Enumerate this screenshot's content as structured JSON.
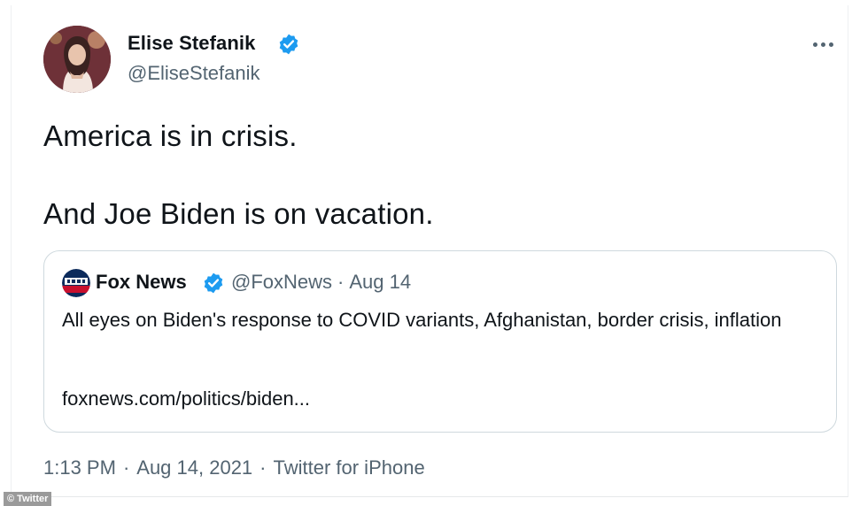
{
  "tweet": {
    "author": {
      "name": "Elise Stefanik",
      "handle": "@EliseStefanik",
      "verified": true,
      "avatar_icon": "profile-photo"
    },
    "text_lines": [
      "America is in crisis.",
      "And Joe Biden is on vacation."
    ],
    "quoted_tweet": {
      "author_name": "Fox News",
      "author_handle": "@FoxNews",
      "separator": "·",
      "date": "Aug 14",
      "verified": true,
      "logo_icon": "fox-news-logo",
      "text": "All eyes on Biden's response to COVID variants, Afghanistan, border crisis, inflation",
      "link": "foxnews.com/politics/biden..."
    },
    "timestamp": {
      "time": "1:13 PM",
      "date": "Aug 14, 2021",
      "source": "Twitter for iPhone",
      "separator": "·"
    },
    "more_icon": "more-options-icon"
  },
  "credit": "© Twitter",
  "colors": {
    "text_primary": "#0f1419",
    "text_secondary": "#536471",
    "verified_blue": "#1d9bf0",
    "border": "#cfd9de"
  }
}
